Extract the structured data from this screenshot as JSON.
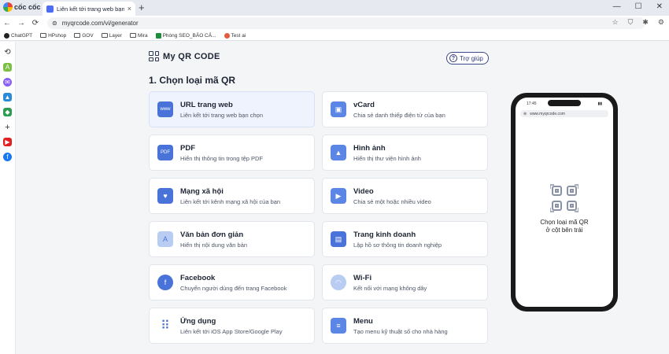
{
  "browser": {
    "name": "cốc cốc",
    "tab_title": "Liên kết tới trang web bạn c",
    "tab_close": "×",
    "new_tab": "+",
    "url": "myqrcode.com/vi/generator",
    "bookmarks": [
      "ChatGPT",
      "HPshop",
      "GOV",
      "Layer",
      "Mira",
      "Phòng SEO_BẢO CẢ...",
      "Test ai"
    ]
  },
  "site": {
    "brand": "My QR CODE",
    "help_label": "Trợ giúp",
    "section_title": "1. Chọn loại mã QR"
  },
  "cards": [
    {
      "title": "URL trang web",
      "desc": "Liên kết tới trang web bạn chọn",
      "icon": "www-icon",
      "color": "#4a73d9",
      "selected": true
    },
    {
      "title": "vCard",
      "desc": "Chia sẻ danh thiếp điện tử của bạn",
      "icon": "vcard-icon",
      "color": "#5b86e5",
      "selected": false
    },
    {
      "title": "PDF",
      "desc": "Hiển thị thông tin trong tệp PDF",
      "icon": "pdf-icon",
      "color": "#4a73d9",
      "selected": false
    },
    {
      "title": "Hình ảnh",
      "desc": "Hiển thị thư viện hình ảnh",
      "icon": "image-icon",
      "color": "#5b86e5",
      "selected": false
    },
    {
      "title": "Mạng xã hội",
      "desc": "Liên kết tới kênh mạng xã hội của bạn",
      "icon": "social-icon",
      "color": "#4a73d9",
      "selected": false
    },
    {
      "title": "Video",
      "desc": "Chia sẻ một hoặc nhiều video",
      "icon": "video-icon",
      "color": "#5b86e5",
      "selected": false
    },
    {
      "title": "Văn bản đơn giản",
      "desc": "Hiển thị nội dung văn bản",
      "icon": "text-icon",
      "color": "#b9cdf3",
      "selected": false
    },
    {
      "title": "Trang kinh doanh",
      "desc": "Lập hồ sơ thông tin doanh nghiệp",
      "icon": "briefcase-icon",
      "color": "#4a73d9",
      "selected": false
    },
    {
      "title": "Facebook",
      "desc": "Chuyển người dùng đến trang Facebook",
      "icon": "facebook-icon",
      "color": "#4a73d9",
      "selected": false
    },
    {
      "title": "Wi-Fi",
      "desc": "Kết nối với mạng không dây",
      "icon": "wifi-icon",
      "color": "#b9cdf3",
      "selected": false
    },
    {
      "title": "Ứng dụng",
      "desc": "Liên kết tới iOS App Store/Google Play",
      "icon": "apps-icon",
      "color": "#4a73d9",
      "selected": false
    },
    {
      "title": "Menu",
      "desc": "Tạo menu kỹ thuật số cho nhà hàng",
      "icon": "menu-icon",
      "color": "#5b86e5",
      "selected": false
    }
  ],
  "phone": {
    "time": "17:45",
    "url": "www.myqrcode.com",
    "message_line1": "Chọn loại mã QR",
    "message_line2": "ở cột bên trái"
  }
}
